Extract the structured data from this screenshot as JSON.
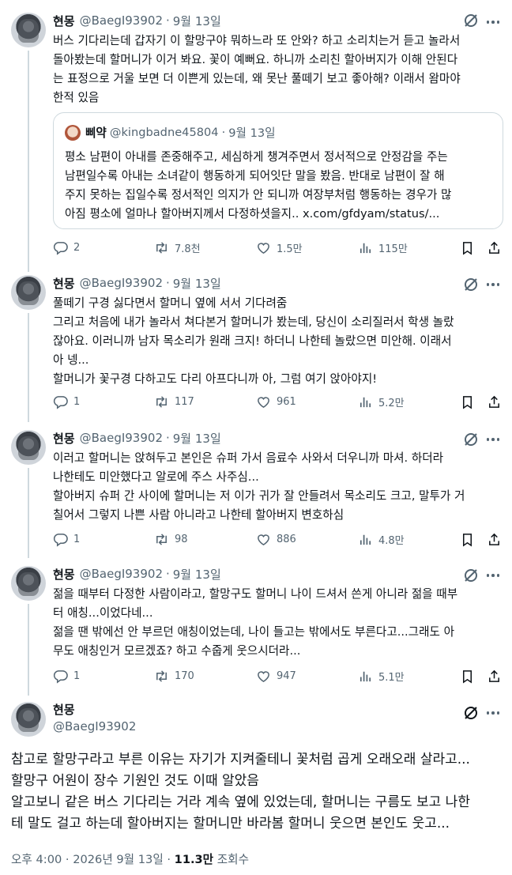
{
  "tweets": [
    {
      "name": "현몽",
      "handle": "@BaegI93902",
      "dot": "·",
      "date": "9월 13일",
      "text": "버스 기다리는데 갑자기 이 할망구야 뭐하느라 또 안와? 하고 소리치는거 듣고 놀라서\n돌아봤는데 할머니가 이거 봐요. 꽃이 예뻐요. 하니까 소리친 할아버지가 이해 안된다\n는 표정으로 거울 보면 더 이쁜게 있는데, 왜 못난 풀떼기 보고 좋아해? 이래서 왐마야\n한적 있음",
      "quote": {
        "name": "삐약",
        "handle": "@kingbadne45804",
        "dot": "·",
        "date": "9월 13일",
        "text": "평소 남편이 아내를 존중해주고, 세심하게 챙겨주면서 정서적으로 안정감을 주는\n남편일수록 아내는 소녀같이 행동하게 되어잇단 말을 봤음. 반대로 남편이 잘 해\n주지 못하는 집일수록 정서적인 의지가 안 되니까 여장부처럼 행동하는 경우가 많\n아짐 평소에 얼마나 할아버지께서 다정하셧을지.. x.com/gfdyam/status/..."
      },
      "replies": "2",
      "retweets": "7.8천",
      "likes": "1.5만",
      "views": "115만"
    },
    {
      "name": "현몽",
      "handle": "@BaegI93902",
      "dot": "·",
      "date": "9월 13일",
      "text": "풀떼기 구경 싫다면서 할머니 옆에 서서 기다려줌\n그리고 처음에 내가 놀라서 쳐다본거 할머니가 봤는데, 당신이 소리질러서 학생 놀랐\n잖아요. 이러니까 남자 목소리가 원래 크지! 하더니 나한테 놀랐으면 미안해. 이래서\n아 넹...\n할머니가 꽃구경 다하고도 다리 아프다니까 아, 그럼 여기 앉아야지!",
      "replies": "1",
      "retweets": "117",
      "likes": "961",
      "views": "5.2만"
    },
    {
      "name": "현몽",
      "handle": "@BaegI93902",
      "dot": "·",
      "date": "9월 13일",
      "text": "이러고 할머니는 앉혀두고 본인은 슈퍼 가서 음료수 사와서 더우니까 마셔. 하더라\n나한테도 미안했다고 알로에 주스 사주심...\n할아버지 슈퍼 간 사이에 할머니는 저 이가 귀가 잘 안들려서 목소리도 크고, 말투가 거\n칠어서 그렇지 나쁜 사람 아니라고 나한테 할아버지 변호하심",
      "replies": "1",
      "retweets": "98",
      "likes": "886",
      "views": "4.8만"
    },
    {
      "name": "현몽",
      "handle": "@BaegI93902",
      "dot": "·",
      "date": "9월 13일",
      "text": "젊을 때부터 다정한 사람이라고, 할망구도 할머니 나이 드셔서 쓴게 아니라 젊을 때부\n터 애칭...이었다네...\n젊을 땐 밖에선 안 부르던 애칭이었는데, 나이 들고는 밖에서도 부른다고...그래도 아\n무도 애칭인거 모르겠죠? 하고 수줍게 웃으시더라...",
      "replies": "1",
      "retweets": "170",
      "likes": "947",
      "views": "5.1만"
    }
  ],
  "main": {
    "name": "현몽",
    "handle": "@BaegI93902",
    "text": "참고로 할망구라고 부른 이유는 자기가 지켜줄테니 꽃처럼 곱게 오래오래 살라고...\n할망구 어원이 장수 기원인 것도 이때 알았음\n알고보니 같은 버스 기다리는 거라 계속 옆에 있었는데, 할머니는 구름도 보고 나한\n테 말도 걸고 하는데 할아버지는 할머니만 바라봄 할머니 웃으면 본인도 웃고...",
    "time": "오후 4:00",
    "dot": "·",
    "date": "2026년 9월 13일",
    "dot2": "·",
    "views": "11.3만",
    "views_label": "조회수"
  },
  "icons": {
    "reply": "reply-icon",
    "retweet": "retweet-icon",
    "like": "heart-icon",
    "views": "views-chart-icon",
    "bookmark": "bookmark-icon",
    "share": "share-icon",
    "grok": "grok-icon",
    "more": "more-icon"
  },
  "colors": {
    "text": "#0f1419",
    "secondary": "#536471",
    "border": "#cfd9de"
  }
}
